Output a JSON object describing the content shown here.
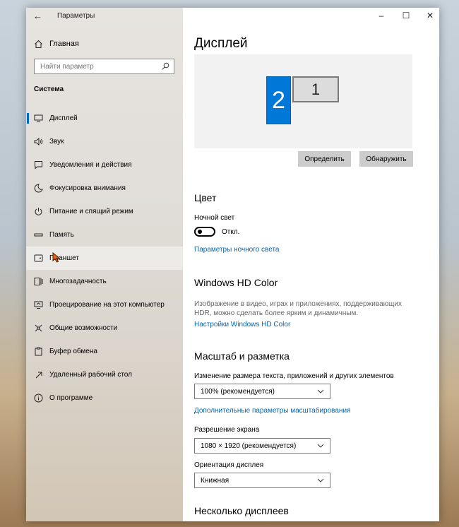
{
  "window": {
    "title": "Параметры"
  },
  "sidebar": {
    "home_label": "Главная",
    "search_placeholder": "Найти параметр",
    "section_label": "Система",
    "items": [
      {
        "label": "Дисплей",
        "icon": "monitor-icon",
        "selected": true
      },
      {
        "label": "Звук",
        "icon": "speaker-icon"
      },
      {
        "label": "Уведомления и действия",
        "icon": "notification-icon"
      },
      {
        "label": "Фокусировка внимания",
        "icon": "moon-icon"
      },
      {
        "label": "Питание и спящий режим",
        "icon": "power-icon"
      },
      {
        "label": "Память",
        "icon": "storage-icon"
      },
      {
        "label": "Планшет",
        "icon": "tablet-icon"
      },
      {
        "label": "Многозадачность",
        "icon": "multitasking-icon"
      },
      {
        "label": "Проецирование на этот компьютер",
        "icon": "projecting-icon"
      },
      {
        "label": "Общие возможности",
        "icon": "share-icon"
      },
      {
        "label": "Буфер обмена",
        "icon": "clipboard-icon"
      },
      {
        "label": "Удаленный рабочий стол",
        "icon": "remote-desktop-icon"
      },
      {
        "label": "О программе",
        "icon": "info-icon"
      }
    ]
  },
  "main": {
    "title": "Дисплей",
    "monitors": {
      "primary": "2",
      "secondary": "1"
    },
    "identify_label": "Определить",
    "detect_label": "Обнаружить",
    "color_section": "Цвет",
    "night_light_label": "Ночной свет",
    "night_light_state": "Откл.",
    "night_light_settings_link": "Параметры ночного света",
    "hdr_section": "Windows HD Color",
    "hdr_desc": "Изображение в видео, играх и приложениях, поддерживающих HDR, можно сделать более ярким и динамичным.",
    "hdr_link": "Настройки Windows HD Color",
    "scale_section": "Масштаб и разметка",
    "scale_label": "Изменение размера текста, приложений и других элементов",
    "scale_value": "100% (рекомендуется)",
    "advanced_scale_link": "Дополнительные параметры масштабирования",
    "resolution_label": "Разрешение экрана",
    "resolution_value": "1080 × 1920 (рекомендуется)",
    "orientation_label": "Ориентация дисплея",
    "orientation_value": "Книжная",
    "multi_section": "Несколько дисплеев"
  },
  "colors": {
    "accent": "#0078d7",
    "link": "#0066b4",
    "button": "#cccccc"
  }
}
